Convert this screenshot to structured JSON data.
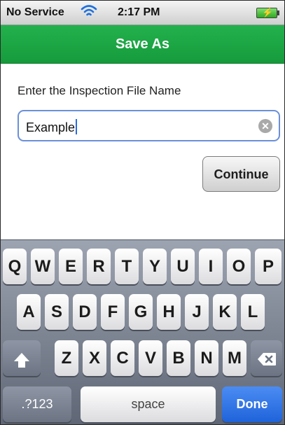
{
  "status_bar": {
    "carrier": "No Service",
    "time": "2:17 PM",
    "wifi_icon": "wifi-icon",
    "battery_icon": "battery-charging-icon"
  },
  "navbar": {
    "title": "Save As"
  },
  "form": {
    "prompt": "Enter the Inspection File Name",
    "filename_value": "Example",
    "clear_icon": "clear-icon",
    "continue_label": "Continue"
  },
  "keyboard": {
    "row1": [
      "Q",
      "W",
      "E",
      "R",
      "T",
      "Y",
      "U",
      "I",
      "O",
      "P"
    ],
    "row2": [
      "A",
      "S",
      "D",
      "F",
      "G",
      "H",
      "J",
      "K",
      "L"
    ],
    "row3": [
      "Z",
      "X",
      "C",
      "V",
      "B",
      "N",
      "M"
    ],
    "numbers_label": ".?123",
    "space_label": "space",
    "done_label": "Done",
    "shift_icon": "shift-icon",
    "backspace_icon": "backspace-icon"
  }
}
